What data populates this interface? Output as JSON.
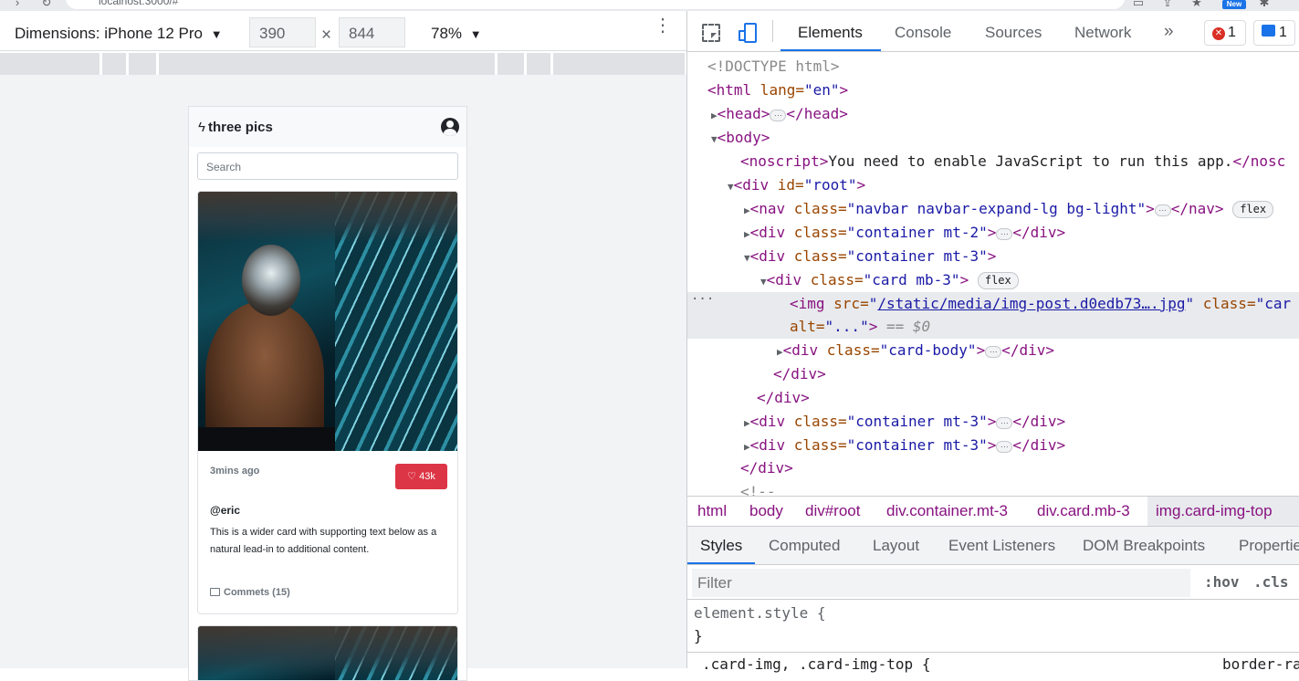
{
  "browser": {
    "url": "localhost:3000/#",
    "new_badge": "New"
  },
  "device_toolbar": {
    "dimensions_label": "Dimensions: iPhone 12 Pro",
    "width": "390",
    "height": "844",
    "times": "×",
    "zoom": "78%",
    "dropdown_glyph": "▼",
    "more_glyph": "⋮"
  },
  "app": {
    "brand": "three pics",
    "search_placeholder": "Search",
    "posts": [
      {
        "time": "3mins ago",
        "likes": "43k",
        "handle": "@eric",
        "text": "This is a wider card with supporting text below as a natural lead-in to additional content.",
        "comments": "Commets (15)"
      }
    ],
    "colors": {
      "like": "#dc3545",
      "navbar": "#f8f9fa"
    }
  },
  "devtools": {
    "tabs": [
      "Elements",
      "Console",
      "Sources",
      "Network"
    ],
    "more_tabs": "»",
    "error_count": "1",
    "message_count": "1",
    "dom_lines": {
      "doctype": "<!DOCTYPE html>",
      "html_open": "<html",
      "html_attr": " lang=",
      "html_val": "\"en\"",
      "head_open": "<head>",
      "head_close": "</head>",
      "body_open": "<body>",
      "noscript_open": "<noscript>",
      "noscript_text": "You need to enable JavaScript to run this app.",
      "noscript_close": "</nosc",
      "root_open": "<div",
      "root_attr": " id=",
      "root_val": "\"root\"",
      "nav_open": "<nav",
      "nav_attr": " class=",
      "nav_val": "\"navbar navbar-expand-lg bg-light\"",
      "nav_close": "</nav>",
      "flex": "flex",
      "div_open": "<div",
      "class_attr": " class=",
      "container_mt2": "\"container mt-2\"",
      "container_mt3": "\"container mt-3\"",
      "card_mb3": "\"card mb-3\"",
      "img_open": "<img",
      "src_attr": " src=",
      "img_src": "/static/media/img-post.d0edb73….jpg",
      "class_attr_cut": " class=",
      "class_cut_val": "\"car",
      "alt_attr": "alt=",
      "alt_val": "\"...\"",
      "eq_sel": " == $0",
      "card_body": "\"card-body\"",
      "div_close": "</div>",
      "comment_cut": "<!--",
      "gt": ">",
      "ellipsis": "···",
      "sel_dots": "···"
    },
    "breadcrumbs": [
      "html",
      "body",
      "div#root",
      "div.container.mt-3",
      "div.card.mb-3",
      "img.card-img-top"
    ],
    "styles_tabs": [
      "Styles",
      "Computed",
      "Layout",
      "Event Listeners",
      "DOM Breakpoints",
      "Properties"
    ],
    "filter_placeholder": "Filter",
    "hov": ":hov",
    "cls": ".cls",
    "element_style": "element.style {",
    "close_brace": "}",
    "rule_selector": ".card-img, .card-img-top {",
    "rule_prop": "border-ra"
  }
}
